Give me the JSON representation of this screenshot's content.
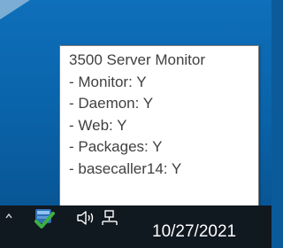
{
  "tooltip": {
    "lines": [
      "3500 Server Monitor",
      "- Monitor: Y",
      "- Daemon: Y",
      "- Web: Y",
      "- Packages: Y",
      "- basecaller14: Y"
    ]
  },
  "taskbar": {
    "clock": "10/27/2021",
    "icons": {
      "overflow": "chevron-up-icon",
      "app": "server-monitor-check-icon",
      "volume": "speaker-icon",
      "network": "network-icon"
    }
  },
  "colors": {
    "desktop": "#0a63a9",
    "taskbar": "#101820",
    "tooltip_bg": "#ffffff",
    "tooltip_text": "#404040",
    "check_green": "#3cb043"
  }
}
